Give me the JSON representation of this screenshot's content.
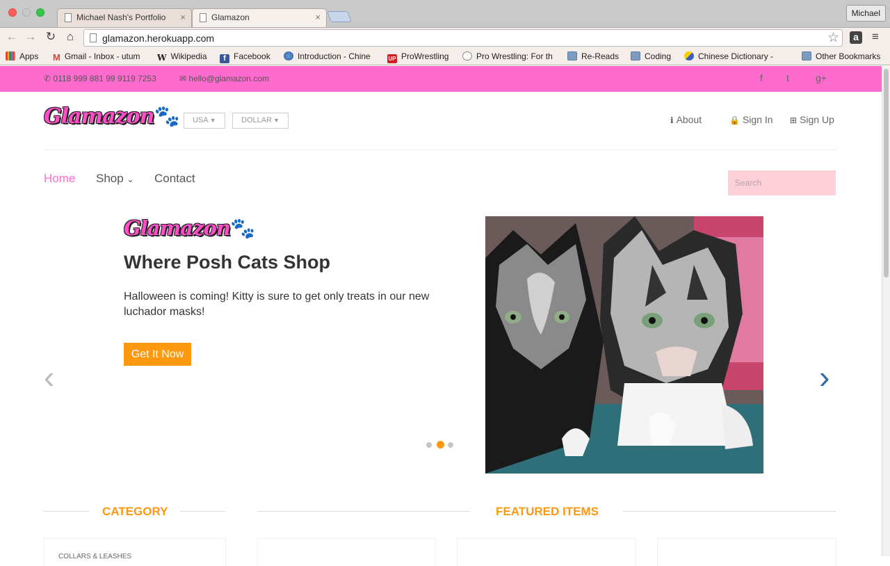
{
  "browser": {
    "tabs": [
      {
        "title": "Michael Nash's Portfolio",
        "close": "×"
      },
      {
        "title": "Glamazon",
        "close": "×"
      }
    ],
    "profile": "Michael",
    "url": "glamazon.herokuapp.com",
    "ext_letter": "a",
    "bookmarks": [
      {
        "label": "Apps",
        "icon": "apps-grid-icon"
      },
      {
        "label": "Gmail - Inbox - utum",
        "icon": "gmail-icon"
      },
      {
        "label": "Wikipedia",
        "icon": "wikipedia-icon"
      },
      {
        "label": "Facebook",
        "icon": "facebook-icon"
      },
      {
        "label": "Introduction - Chine",
        "icon": "globe-icon"
      },
      {
        "label": "ProWrestling",
        "icon": "up-icon"
      },
      {
        "label": "Pro Wrestling: For th",
        "icon": "reddit-icon"
      },
      {
        "label": "Re-Reads",
        "icon": "folder-icon"
      },
      {
        "label": "Coding",
        "icon": "folder-icon"
      },
      {
        "label": "Chinese Dictionary -",
        "icon": "dictionary-icon"
      },
      {
        "label": "Other Bookmarks",
        "icon": "folder-icon"
      }
    ]
  },
  "topbar": {
    "phone": "0118 999 881 99 9119 7253",
    "email": "hello@glamazon.com",
    "social": [
      "f",
      "t",
      "g+"
    ]
  },
  "header": {
    "logo": "Glamazon",
    "country": "USA",
    "currency": "DOLLAR",
    "links": [
      {
        "label": "About",
        "icon": "info-icon"
      },
      {
        "label": "Sign In",
        "icon": "lock-icon"
      },
      {
        "label": "Sign Up",
        "icon": "plus-square-icon"
      }
    ]
  },
  "nav": {
    "items": [
      "Home",
      "Shop",
      "Contact"
    ],
    "search_placeholder": "Search"
  },
  "hero": {
    "logo": "Glamazon",
    "title": "Where Posh Cats Shop",
    "text": "Halloween is coming! Kitty is sure to get only treats in our new luchador masks!",
    "cta": "Get It Now",
    "active_slide": 2,
    "slide_count": 3
  },
  "sections": {
    "category": "CATEGORY",
    "featured": "FEATURED ITEMS",
    "first_category": "COLLARS & LEASHES"
  },
  "colors": {
    "brand_pink": "#fe6bce",
    "accent_orange": "#fe980f"
  }
}
